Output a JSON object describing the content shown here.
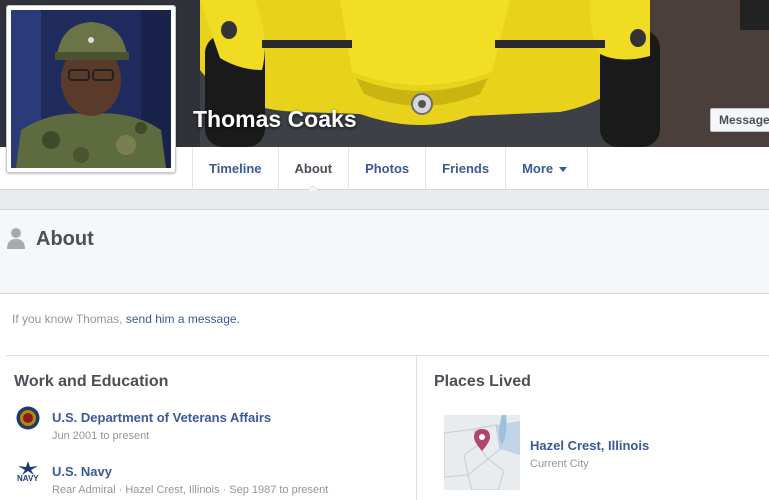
{
  "profile": {
    "name": "Thomas Coaks",
    "message_button": "Message"
  },
  "tabs": [
    {
      "label": "Timeline"
    },
    {
      "label": "About"
    },
    {
      "label": "Photos"
    },
    {
      "label": "Friends"
    },
    {
      "label": "More"
    }
  ],
  "about": {
    "title": "About",
    "hint_prefix": "If you know Thomas,",
    "hint_link": "send him a message."
  },
  "work": {
    "title": "Work and Education",
    "items": [
      {
        "name": "U.S. Department of Veterans Affairs",
        "detail": "Jun 2001 to present",
        "icon": "va-seal-icon"
      },
      {
        "name": "U.S. Navy",
        "detail": "Rear Admiral · Hazel Crest, Illinois · Sep 1987 to present",
        "icon": "navy-logo-icon",
        "icon_text": "NAVY"
      }
    ]
  },
  "places": {
    "title": "Places Lived",
    "items": [
      {
        "name": "Hazel Crest, Illinois",
        "detail": "Current City",
        "icon": "map-pin-icon"
      }
    ]
  },
  "colors": {
    "link": "#3b5998",
    "muted": "#90949c",
    "heading": "#4b4f56"
  }
}
